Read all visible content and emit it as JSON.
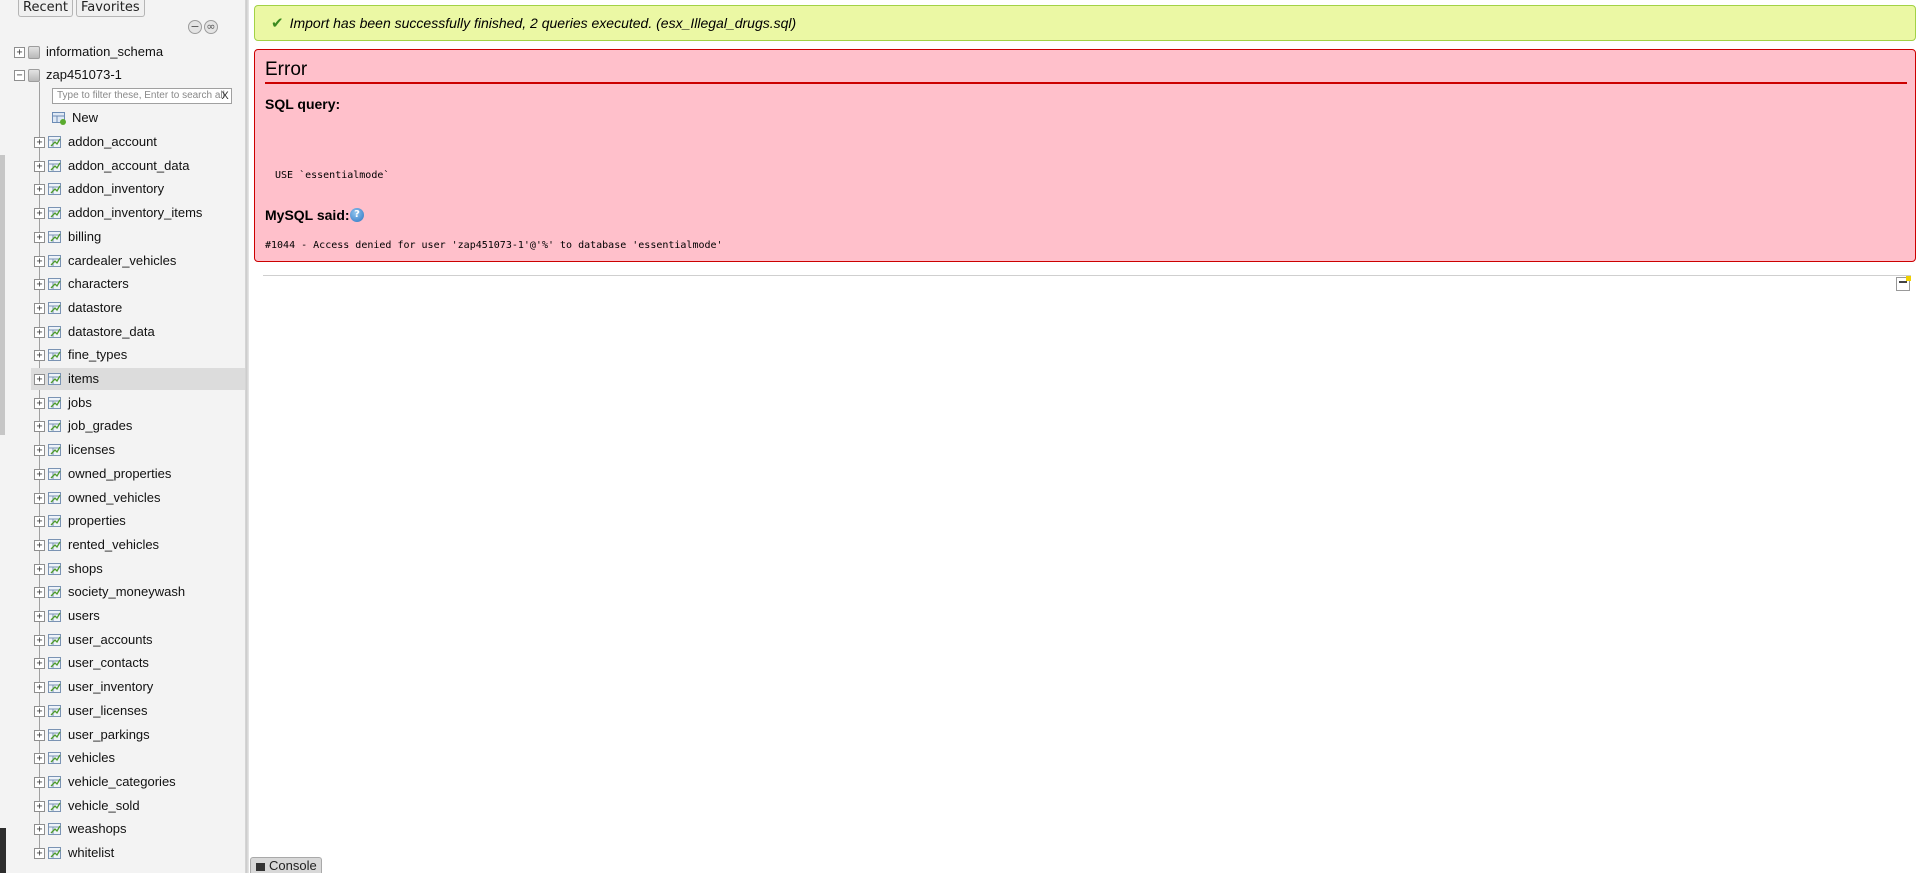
{
  "nav": {
    "tabs": [
      {
        "label": "Recent"
      },
      {
        "label": "Favorites"
      }
    ],
    "collapse_symbol": "−",
    "link_symbol": "∞",
    "databases": [
      {
        "name": "information_schema",
        "expander": "+"
      },
      {
        "name": "zap451073-1",
        "expander": "−"
      }
    ],
    "filter": {
      "placeholder": "Type to filter these, Enter to search all",
      "clear_label": "X"
    },
    "new_label": "New",
    "table_expander": "+",
    "tables": [
      "addon_account",
      "addon_account_data",
      "addon_inventory",
      "addon_inventory_items",
      "billing",
      "cardealer_vehicles",
      "characters",
      "datastore",
      "datastore_data",
      "fine_types",
      "items",
      "jobs",
      "job_grades",
      "licenses",
      "owned_properties",
      "owned_vehicles",
      "properties",
      "rented_vehicles",
      "shops",
      "society_moneywash",
      "users",
      "user_accounts",
      "user_contacts",
      "user_inventory",
      "user_licenses",
      "user_parkings",
      "vehicles",
      "vehicle_categories",
      "vehicle_sold",
      "weashops",
      "whitelist"
    ],
    "highlighted_table": "items"
  },
  "notice": {
    "check_symbol": "✔",
    "text": "Import has been successfully finished, 2 queries executed. (esx_Illegal_drugs.sql)"
  },
  "error": {
    "title": "Error",
    "sql_query_label": "SQL query:",
    "sql_code": "USE `essentialmode`",
    "mysql_said_label": "MySQL said:",
    "help_symbol": "?",
    "message": "#1044 - Access denied for user 'zap451073-1'@'%' to database 'essentialmode'"
  },
  "console": {
    "label": "Console"
  },
  "colors": {
    "success_bg": "#ebf8a4",
    "error_bg": "#ffc0cb",
    "error_border": "#cc0000"
  }
}
